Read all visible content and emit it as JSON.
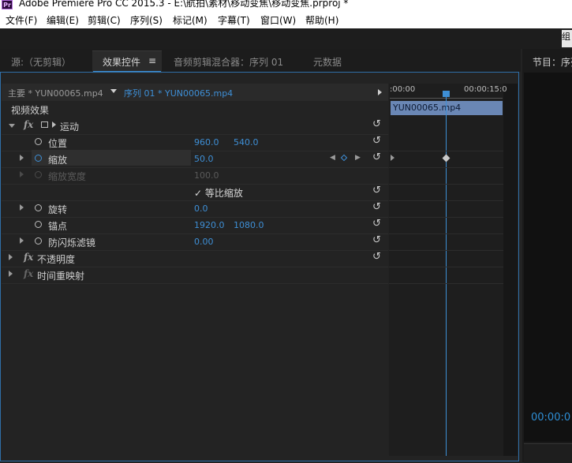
{
  "window": {
    "app_badge": "Pr",
    "title": "Adobe Premiere Pro CC 2015.3 - E:\\航拍\\素材\\移动变焦\\移动变焦.prproj *"
  },
  "menu": [
    "文件(F)",
    "编辑(E)",
    "剪辑(C)",
    "序列(S)",
    "标记(M)",
    "字幕(T)",
    "窗口(W)",
    "帮助(H)"
  ],
  "top_right_fragment": "组",
  "tabs": [
    {
      "label": "源:（无剪辑）"
    },
    {
      "label": "效果控件"
    },
    {
      "label": "音频剪辑混合器：序列 01"
    },
    {
      "label": "元数据"
    }
  ],
  "tab_menu_icon": "≡",
  "right_panel": {
    "title": "节目：序列",
    "timecode": "00:00:0"
  },
  "header": {
    "master_clip": "主要 * YUN00065.mp4",
    "sequence_clip": "序列 01 * YUN00065.mp4"
  },
  "timeline": {
    "tc_start": ":00:00",
    "tc_end": "00:00:15:0",
    "clip_name": "YUN00065.mp4"
  },
  "section_title": "视频效果",
  "effects": {
    "motion": {
      "label": "运动",
      "position": {
        "label": "位置",
        "x": "960.0",
        "y": "540.0"
      },
      "scale": {
        "label": "缩放",
        "value": "50.0"
      },
      "scale_width": {
        "label": "缩放宽度",
        "value": "100.0"
      },
      "uniform_scale": {
        "label": "等比缩放",
        "checked": true
      },
      "rotation": {
        "label": "旋转",
        "value": "0.0"
      },
      "anchor": {
        "label": "锚点",
        "x": "1920.0",
        "y": "1080.0"
      },
      "anti_flicker": {
        "label": "防闪烁滤镜",
        "value": "0.00"
      }
    },
    "opacity": {
      "label": "不透明度"
    },
    "time_remap": {
      "label": "时间重映射"
    }
  },
  "icons": {
    "fx": "fx",
    "reset": "↺",
    "check": "✓"
  },
  "colors": {
    "accent": "#3e8fd6",
    "clip": "#6a87b5",
    "panel_bg": "#232323"
  }
}
